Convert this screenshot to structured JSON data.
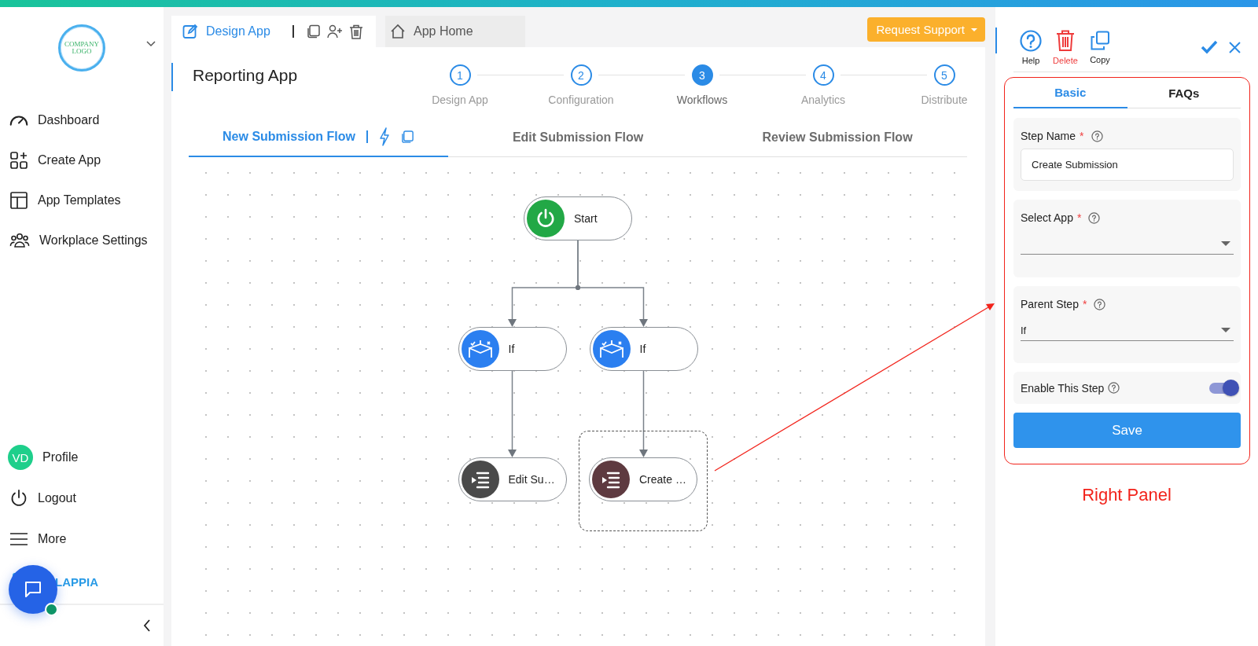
{
  "sidebar": {
    "logo_text": [
      "COMPANY",
      "LOGO"
    ],
    "nav_items": [
      {
        "label": "Dashboard"
      },
      {
        "label": "Create App"
      },
      {
        "label": "App Templates"
      },
      {
        "label": "Workplace Settings"
      }
    ],
    "profile": {
      "initials": "VD",
      "label": "Profile"
    },
    "bottom_items": [
      {
        "label": "Logout"
      },
      {
        "label": "More"
      }
    ],
    "brand": "LAPPIA"
  },
  "chat": {
    "online": true
  },
  "app_tabs": [
    {
      "label": "Design App",
      "selected": true
    },
    {
      "label": "App Home",
      "selected": false
    }
  ],
  "support_button": {
    "label": "Request Support"
  },
  "app_title": "Reporting App",
  "steps": [
    {
      "number": "1",
      "label": "Design App",
      "selected": false
    },
    {
      "number": "2",
      "label": "Configuration",
      "selected": false
    },
    {
      "number": "3",
      "label": "Workflows",
      "selected": true
    },
    {
      "number": "4",
      "label": "Analytics",
      "selected": false
    },
    {
      "number": "5",
      "label": "Distribute",
      "selected": false
    }
  ],
  "flow_tabs": [
    {
      "label": "New Submission Flow",
      "selected": true
    },
    {
      "label": "Edit Submission Flow",
      "selected": false
    },
    {
      "label": "Review Submission Flow",
      "selected": false
    }
  ],
  "flow": {
    "start": {
      "kind": "start",
      "label": "Start",
      "selected": false,
      "children": [
        {
          "kind": "condition",
          "label": "If",
          "selected": false,
          "children": [
            {
              "kind": "action",
              "label": "Edit Su…",
              "color": "#4a4a4a",
              "selected": false
            }
          ]
        },
        {
          "kind": "condition",
          "label": "If",
          "selected": false,
          "children": [
            {
              "kind": "action",
              "label": "Create …",
              "color": "#5e3a40",
              "selected": true
            }
          ]
        }
      ]
    }
  },
  "right_panel": {
    "toolbar": [
      {
        "kind": "help",
        "label": "Help"
      },
      {
        "kind": "delete",
        "label": "Delete"
      },
      {
        "kind": "copy",
        "label": "Copy"
      }
    ],
    "tabs": [
      {
        "label": "Basic",
        "selected": true
      },
      {
        "label": "FAQs",
        "selected": false
      }
    ],
    "fields": [
      {
        "kind": "text",
        "label": "Step Name",
        "required_mark": "*",
        "value": "Create Submission"
      },
      {
        "kind": "select",
        "label": "Select App",
        "required_mark": "*"
      },
      {
        "kind": "select",
        "label": "Parent Step",
        "required_mark": "*",
        "value": "If"
      },
      {
        "kind": "toggle",
        "label": "Enable This Step",
        "on": true
      }
    ],
    "save_button": "Save"
  },
  "annotation": {
    "label": "Right Panel"
  }
}
